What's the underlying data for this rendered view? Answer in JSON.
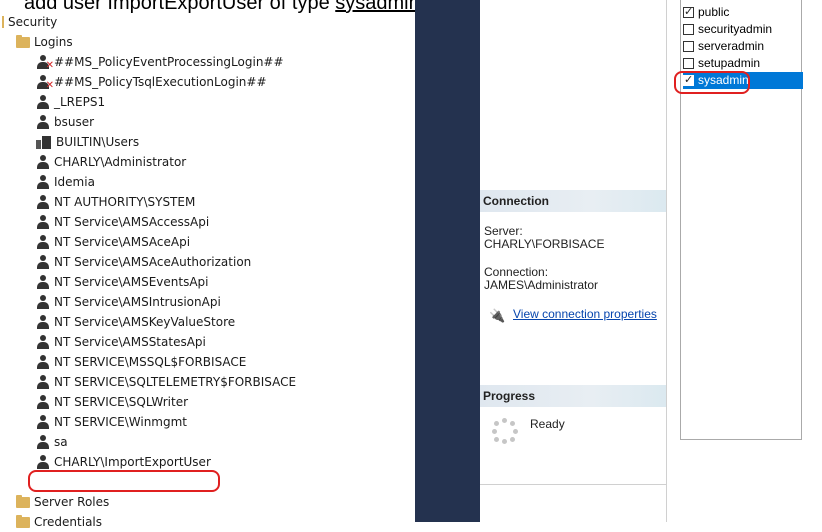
{
  "caption": {
    "text": "add user ImportExportUser of type ",
    "tail": "sysadmin under Security > Logins"
  },
  "tree": {
    "security_label": "Security",
    "logins_label": "Logins",
    "logins": [
      "##MS_PolicyEventProcessingLogin##",
      "##MS_PolicyTsqlExecutionLogin##",
      "_LREPS1",
      "bsuser",
      "BUILTIN\\Users",
      "CHARLY\\Administrator",
      "Idemia",
      "NT AUTHORITY\\SYSTEM",
      "NT Service\\AMSAccessApi",
      "NT Service\\AMSAceApi",
      "NT Service\\AMSAceAuthorization",
      "NT Service\\AMSEventsApi",
      "NT Service\\AMSIntrusionApi",
      "NT Service\\AMSKeyValueStore",
      "NT Service\\AMSStatesApi",
      "NT SERVICE\\MSSQL$FORBISACE",
      "NT SERVICE\\SQLTELEMETRY$FORBISACE",
      "NT SERVICE\\SQLWriter",
      "NT SERVICE\\Winmgmt",
      "sa",
      "CHARLY\\ImportExportUser"
    ],
    "server_roles_label": "Server Roles",
    "credentials_label": "Credentials"
  },
  "connection": {
    "header": "Connection",
    "server_label": "Server:",
    "server_value": "CHARLY\\FORBISACE",
    "connection_label": "Connection:",
    "connection_value": "JAMES\\Administrator",
    "link": "View connection properties"
  },
  "progress": {
    "header": "Progress",
    "status": "Ready"
  },
  "roles": [
    {
      "name": "public",
      "checked": true,
      "selected": false
    },
    {
      "name": "securityadmin",
      "checked": false,
      "selected": false
    },
    {
      "name": "serveradmin",
      "checked": false,
      "selected": false
    },
    {
      "name": "setupadmin",
      "checked": false,
      "selected": false
    },
    {
      "name": "sysadmin",
      "checked": true,
      "selected": true
    }
  ],
  "colors": {
    "accent": "#0078d7",
    "highlight": "#e02020",
    "dark_bar": "#24324f"
  }
}
